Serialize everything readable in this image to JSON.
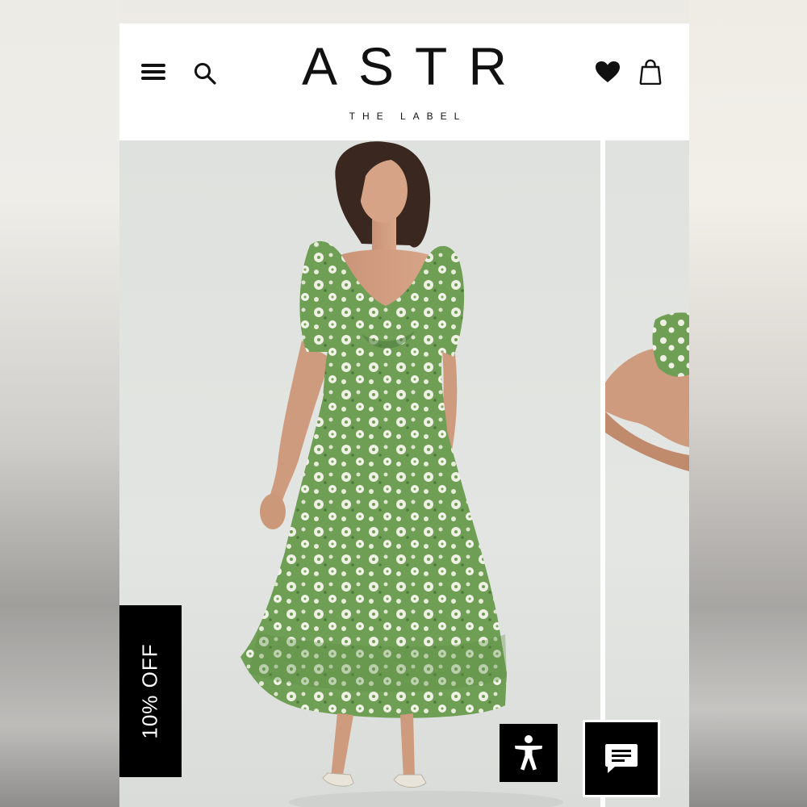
{
  "brand": {
    "logo_text": "ASTR",
    "tagline": "THE LABEL"
  },
  "header": {
    "icons": [
      "hamburger-menu-icon",
      "search-icon",
      "heart-icon",
      "shopping-bag-icon"
    ]
  },
  "gallery": {
    "images": [
      {
        "subject": "model-in-green-floral-midi-dress"
      },
      {
        "subject": "partial-next-image-arm-puff-sleeve"
      }
    ]
  },
  "promo": {
    "label": "10% OFF"
  },
  "widgets": {
    "accessibility_icon": "accessibility-person-icon",
    "chat_icon": "chat-bubble-icon"
  },
  "colors": {
    "header_bg": "#ffffff",
    "text": "#111111",
    "promo_bg": "#000000",
    "dress_green": "#6a9a4e",
    "photo_bg": "#e1e3e0"
  }
}
